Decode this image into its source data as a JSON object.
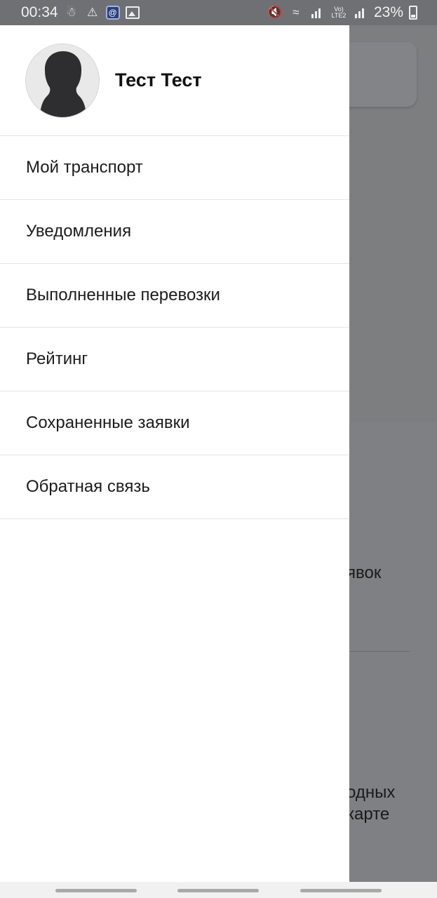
{
  "status_bar": {
    "time": "00:34",
    "network_small_1": "R",
    "network_small_2": "Vo)\nLTE2",
    "battery_percent": "23%"
  },
  "drawer": {
    "user_name": "Тест Тест",
    "menu": [
      {
        "label": "Мой транспорт"
      },
      {
        "label": "Уведомления"
      },
      {
        "label": "Выполненные перевозки"
      },
      {
        "label": "Рейтинг"
      },
      {
        "label": "Сохраненные заявки"
      },
      {
        "label": "Обратная связь"
      }
    ]
  },
  "background": {
    "text_1": "явок",
    "text_2": "одных",
    "text_3": "карте"
  },
  "colors": {
    "scrim": "#7a7b7e",
    "drawer_bg": "#ffffff",
    "divider": "#e4e4e4"
  }
}
